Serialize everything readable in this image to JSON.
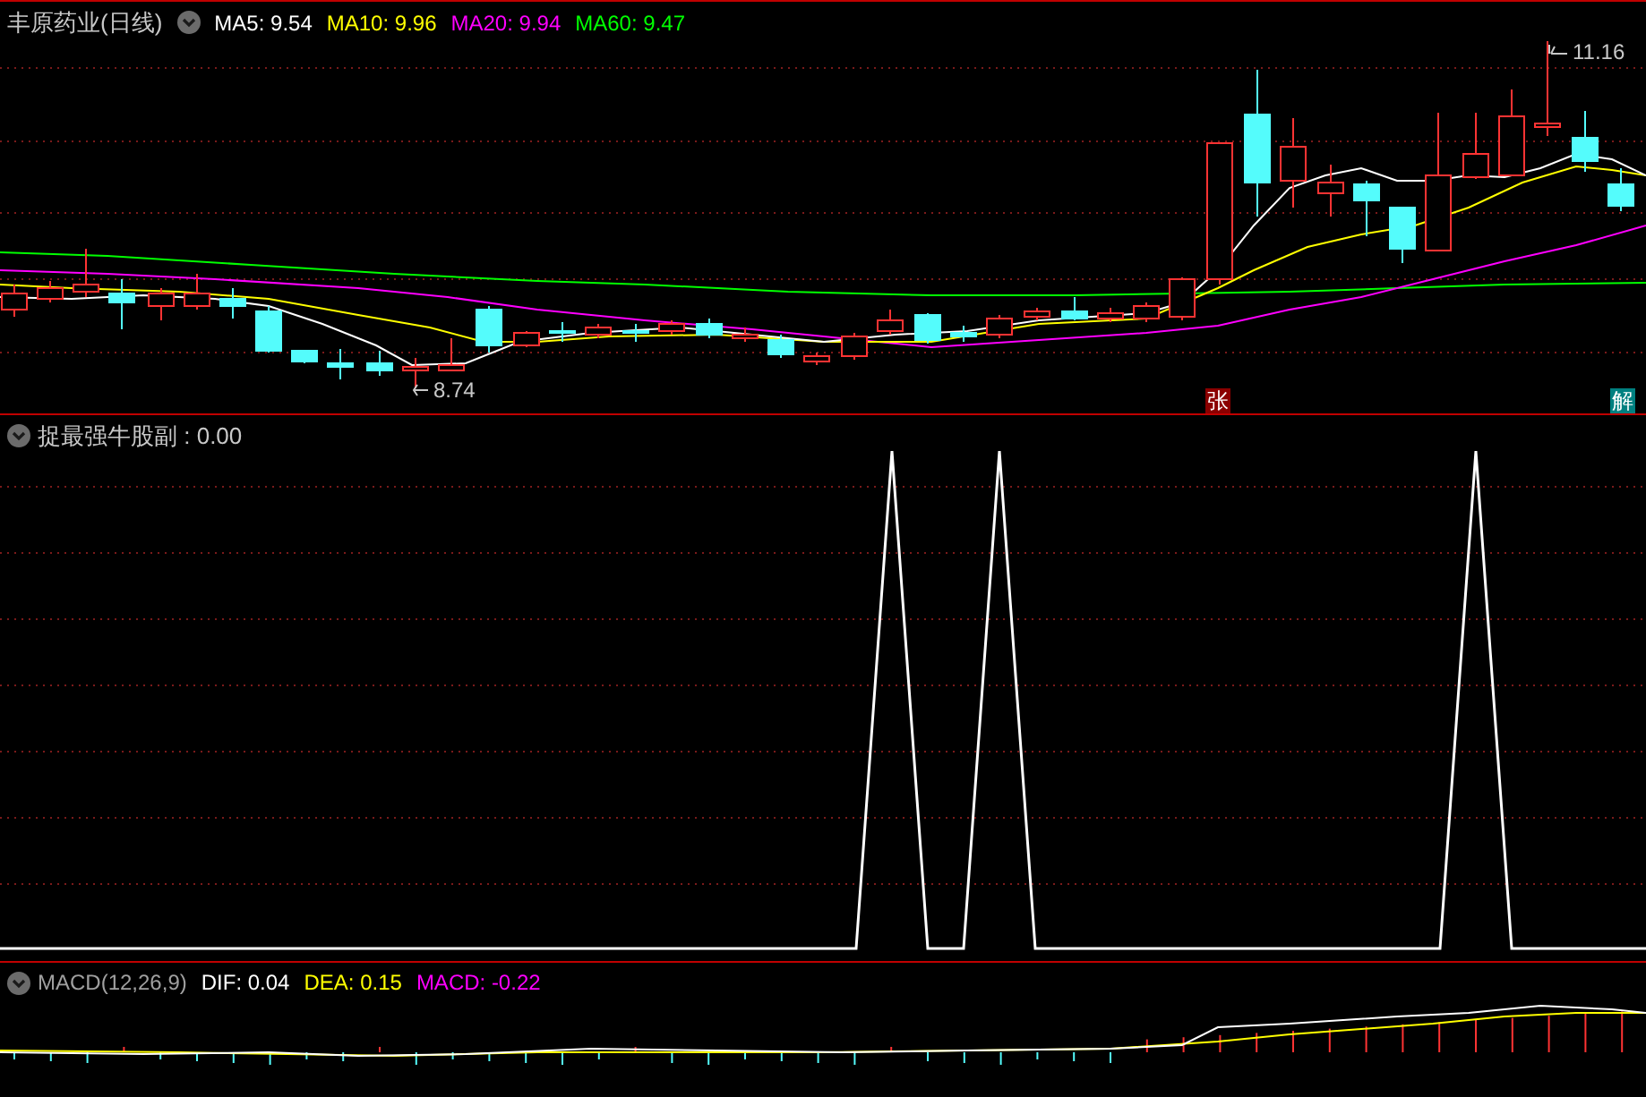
{
  "price_panel": {
    "title": "丰原药业(日线)",
    "ma_legend": [
      {
        "label": "MA5: 9.54",
        "color": "#ffffff"
      },
      {
        "label": "MA10: 9.96",
        "color": "#ffff00"
      },
      {
        "label": "MA20: 9.94",
        "color": "#ff00ff"
      },
      {
        "label": "MA60: 9.47",
        "color": "#00ff00"
      }
    ],
    "low_marker": "8.74",
    "high_marker": "11.16",
    "badges": [
      {
        "text": "张",
        "color": "#8b0000"
      },
      {
        "text": "解",
        "color": "#008080"
      }
    ]
  },
  "indicator_panel": {
    "title": "捉最强牛股副 : 0.00"
  },
  "macd_panel": {
    "title": "MACD(12,26,9)",
    "values": [
      {
        "label": "DIF: 0.04",
        "color": "#ffffff"
      },
      {
        "label": "DEA: 0.15",
        "color": "#ffff00"
      },
      {
        "label": "MACD: -0.22",
        "color": "#ff00ff"
      }
    ]
  }
}
